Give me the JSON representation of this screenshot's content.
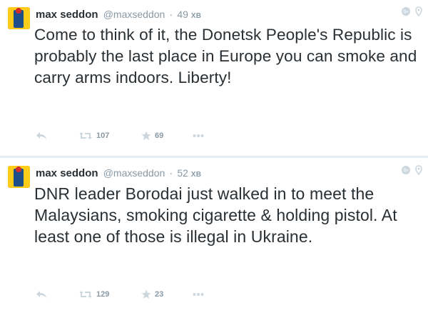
{
  "tweets": [
    {
      "name": "max seddon",
      "handle": "@maxseddon",
      "separator": "·",
      "time_value": "49",
      "time_unit": "ХВ",
      "text": "Come to think of it, the Donetsk People's Republic is probably the last place in Europe you can smoke and carry arms indoors. Liberty!",
      "retweets": "107",
      "favorites": "69"
    },
    {
      "name": "max seddon",
      "handle": "@maxseddon",
      "separator": "·",
      "time_value": "52",
      "time_unit": "ХВ",
      "text": "DNR leader Borodai just walked in to meet the Malaysians, smoking cigarette & holding pistol. At least one of those is illegal in Ukraine.",
      "retweets": "129",
      "favorites": "23"
    }
  ],
  "icons": {
    "reply": "reply-icon",
    "retweet": "retweet-icon",
    "favorite": "star-icon",
    "more": "more-dots-icon",
    "globe": "globe-icon",
    "location": "location-pin-icon"
  },
  "colors": {
    "text": "#292f33",
    "muted": "#8899a6",
    "divider": "#e6ecf0"
  }
}
